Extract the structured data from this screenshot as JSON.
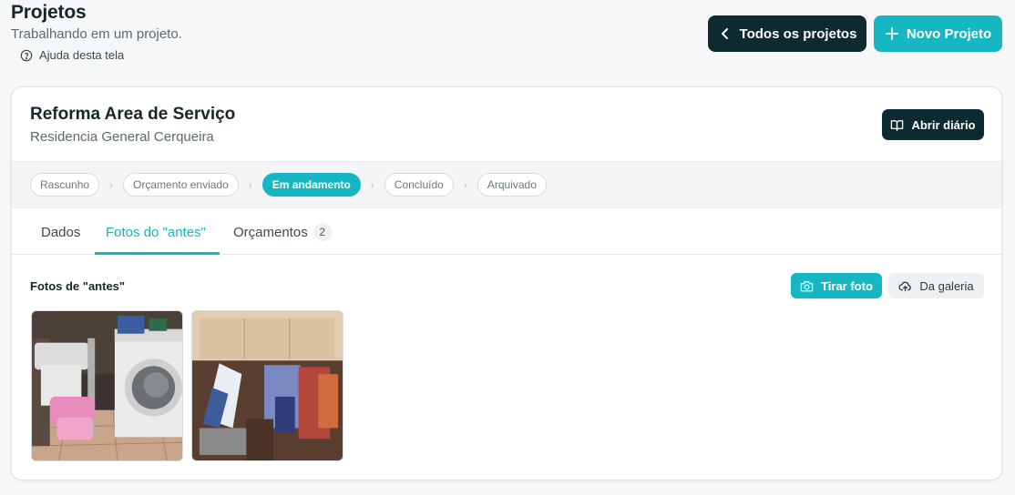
{
  "header": {
    "title": "Projetos",
    "subtitle": "Trabalhando em um projeto.",
    "help_label": "Ajuda desta tela",
    "all_projects_label": "Todos os projetos",
    "new_project_label": "Novo Projeto"
  },
  "project": {
    "title": "Reforma Area de Serviço",
    "client": "Residencia General Cerqueira",
    "diary_label": "Abrir diário"
  },
  "status_steps": [
    {
      "label": "Rascunho",
      "active": false
    },
    {
      "label": "Orçamento enviado",
      "active": false
    },
    {
      "label": "Em andamento",
      "active": true
    },
    {
      "label": "Concluído",
      "active": false
    },
    {
      "label": "Arquivado",
      "active": false
    }
  ],
  "tabs": [
    {
      "label": "Dados"
    },
    {
      "label": "Fotos do \"antes\""
    },
    {
      "label": "Orçamentos",
      "badge": "2"
    }
  ],
  "photos_section": {
    "title": "Fotos de \"antes\"",
    "take_photo_label": "Tirar foto",
    "gallery_label": "Da galeria"
  },
  "colors": {
    "accent": "#16b6c2",
    "dark": "#0c2a30"
  }
}
